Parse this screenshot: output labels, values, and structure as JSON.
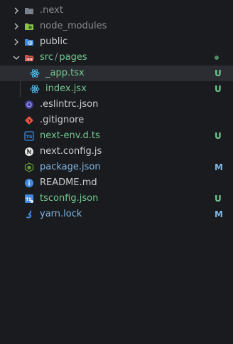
{
  "colors": {
    "background": "#1a1b1f",
    "selected_row": "#2b2d33",
    "default_text": "#cccccc",
    "dimmed_text": "#8b8b8b",
    "untracked_green": "#73c991",
    "modified_blue": "#7fb5e0"
  },
  "explorer": {
    "items": [
      {
        "name": ".next",
        "icon": "folder-icon",
        "kind": "folder"
      },
      {
        "name": "node_modules",
        "icon": "folder-node-icon",
        "kind": "folder"
      },
      {
        "name": "public",
        "icon": "folder-public-icon",
        "kind": "folder"
      },
      {
        "name": "src",
        "sep": "/",
        "name2": "pages",
        "icon": "folder-src-open-icon",
        "kind": "folder-open"
      },
      {
        "name": "_app.tsx",
        "icon": "react-icon",
        "status": "U"
      },
      {
        "name": "index.jsx",
        "icon": "react-icon",
        "status": "U"
      },
      {
        "name": ".eslintrc.json",
        "icon": "eslint-icon"
      },
      {
        "name": ".gitignore",
        "icon": "git-icon"
      },
      {
        "name": "next-env.d.ts",
        "icon": "typescript-icon",
        "status": "U"
      },
      {
        "name": "next.config.js",
        "icon": "nextjs-icon"
      },
      {
        "name": "package.json",
        "icon": "nodejs-icon",
        "status": "M"
      },
      {
        "name": "README.md",
        "icon": "info-icon"
      },
      {
        "name": "tsconfig.json",
        "icon": "tsconfig-icon",
        "status": "U"
      },
      {
        "name": "yarn.lock",
        "icon": "yarn-icon",
        "status": "M"
      }
    ]
  }
}
